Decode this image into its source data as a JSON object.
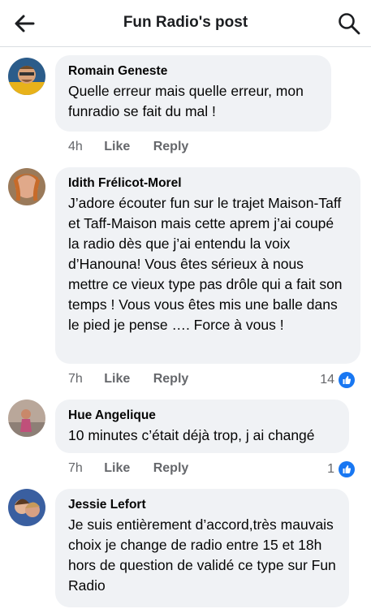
{
  "header": {
    "title": "Fun Radio's post"
  },
  "colors": {
    "accent": "#1877f2",
    "bubble": "#f0f2f5",
    "meta": "#65676b"
  },
  "comments": [
    {
      "author": "Romain Geneste",
      "text": "Quelle erreur mais quelle erreur, mon funradio se fait du mal !",
      "time": "4h",
      "like_label": "Like",
      "reply_label": "Reply",
      "reactions": null
    },
    {
      "author": "Idith Frélicot-Morel",
      "text": "J’adore écouter fun sur le trajet Maison-Taff et Taff-Maison mais cette aprem j’ai coupé la radio dès que j’ai entendu la voix d’Hanouna! Vous êtes sérieux à nous mettre ce vieux type pas drôle qui a fait son temps ! Vous vous êtes mis une balle dans le pied je pense …. Force à vous !",
      "time": "7h",
      "like_label": "Like",
      "reply_label": "Reply",
      "reactions": "14"
    },
    {
      "author": "Hue Angelique",
      "text": "10 minutes c’était déjà trop, j ai changé",
      "time": "7h",
      "like_label": "Like",
      "reply_label": "Reply",
      "reactions": "1"
    },
    {
      "author": "Jessie Lefort",
      "text": "Je suis entièrement d’accord,très mauvais choix je change de radio entre 15 et 18h  hors de question de validé ce type sur Fun Radio",
      "time": "",
      "like_label": "",
      "reply_label": "",
      "reactions": null
    }
  ]
}
